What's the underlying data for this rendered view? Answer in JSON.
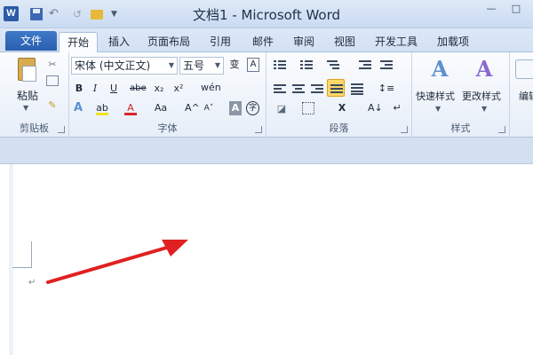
{
  "title_bar": {
    "app_letter": "W",
    "window_title": "文档1 - Microsoft Word",
    "minimize_glyph": "—",
    "maximize_glyph": "□",
    "redo_glyph": "↺",
    "customize_glyph": "▼"
  },
  "tabs": [
    {
      "label": "文件"
    },
    {
      "label": "开始"
    },
    {
      "label": "插入"
    },
    {
      "label": "页面布局"
    },
    {
      "label": "引用"
    },
    {
      "label": "邮件"
    },
    {
      "label": "审阅"
    },
    {
      "label": "视图"
    },
    {
      "label": "开发工具"
    },
    {
      "label": "加载项"
    }
  ],
  "ribbon": {
    "clipboard": {
      "paste_label": "粘贴",
      "group_label": "剪贴板"
    },
    "font": {
      "font_name": "宋体 (中文正文)",
      "font_size": "五号",
      "grow_font": "变",
      "clear_format": "A",
      "bold": "B",
      "italic": "I",
      "underline": "U",
      "strikethrough": "abe",
      "subscript": "x₂",
      "superscript": "x²",
      "phonetic": "wén",
      "text_effects": "A",
      "highlight": "ab",
      "font_color": "A",
      "change_case": "Aa",
      "grow": "A^",
      "shrink": "A˅",
      "char_shading": "A",
      "enclose_char": "字",
      "group_label": "字体"
    },
    "paragraph": {
      "group_label": "段落",
      "line_spacing": "↕≡",
      "chinese_layout": "X",
      "sort": "A↓",
      "show_marks": "↵"
    },
    "styles": {
      "quick_styles": "快速样式",
      "change_styles": "更改样式",
      "group_label": "样式"
    },
    "editing": {
      "label": "编辑"
    }
  },
  "document": {
    "paragraph_mark": "↵"
  },
  "colors": {
    "file_tab": "#2a5fae",
    "ribbon_bg": "#e6eef8",
    "highlight_yellow": "#f2e21f",
    "font_color_red": "#d6262c",
    "annotation_arrow": "#e02020"
  }
}
